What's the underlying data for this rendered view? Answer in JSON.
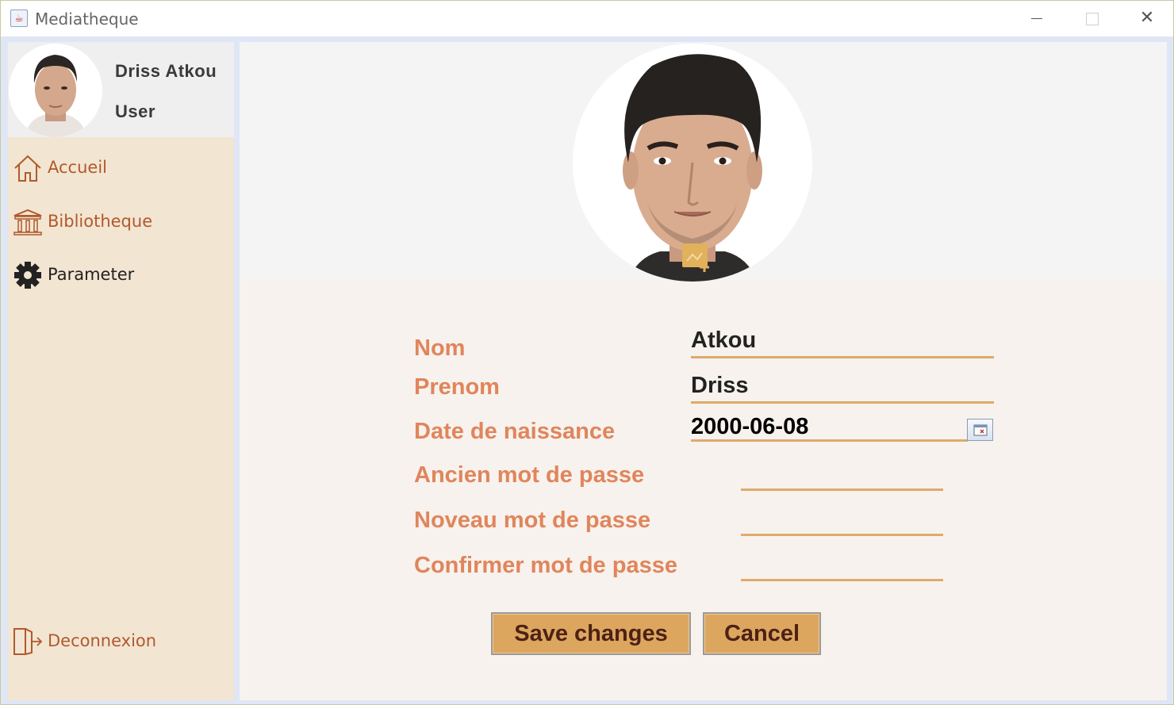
{
  "window": {
    "title": "Mediatheque"
  },
  "user": {
    "name": "Driss Atkou",
    "role": "User"
  },
  "sidebar": {
    "items": [
      {
        "label": "Accueil",
        "icon": "home-icon"
      },
      {
        "label": "Bibliotheque",
        "icon": "library-icon"
      },
      {
        "label": "Parameter",
        "icon": "gear-icon",
        "active": true
      }
    ],
    "logout": {
      "label": "Deconnexion",
      "icon": "logout-icon"
    }
  },
  "form": {
    "nom": {
      "label": "Nom",
      "value": "Atkou"
    },
    "prenom": {
      "label": "Prenom",
      "value": "Driss"
    },
    "date_naissance": {
      "label": "Date de naissance",
      "value": "2000-06-08"
    },
    "ancien_mdp": {
      "label": "Ancien mot de passe",
      "value": ""
    },
    "nouveau_mdp": {
      "label": "Noveau mot de passe",
      "value": ""
    },
    "confirmer_mdp": {
      "label": "Confirmer mot de passe",
      "value": ""
    }
  },
  "actions": {
    "save_label": "Save changes",
    "cancel_label": "Cancel"
  },
  "colors": {
    "sidebar_bg": "#f2e5d1",
    "nav_text": "#b05a2e",
    "label_text": "#e0855c",
    "underline": "#dfaa6e",
    "button_bg": "#dda65f",
    "button_text": "#4d2214"
  }
}
